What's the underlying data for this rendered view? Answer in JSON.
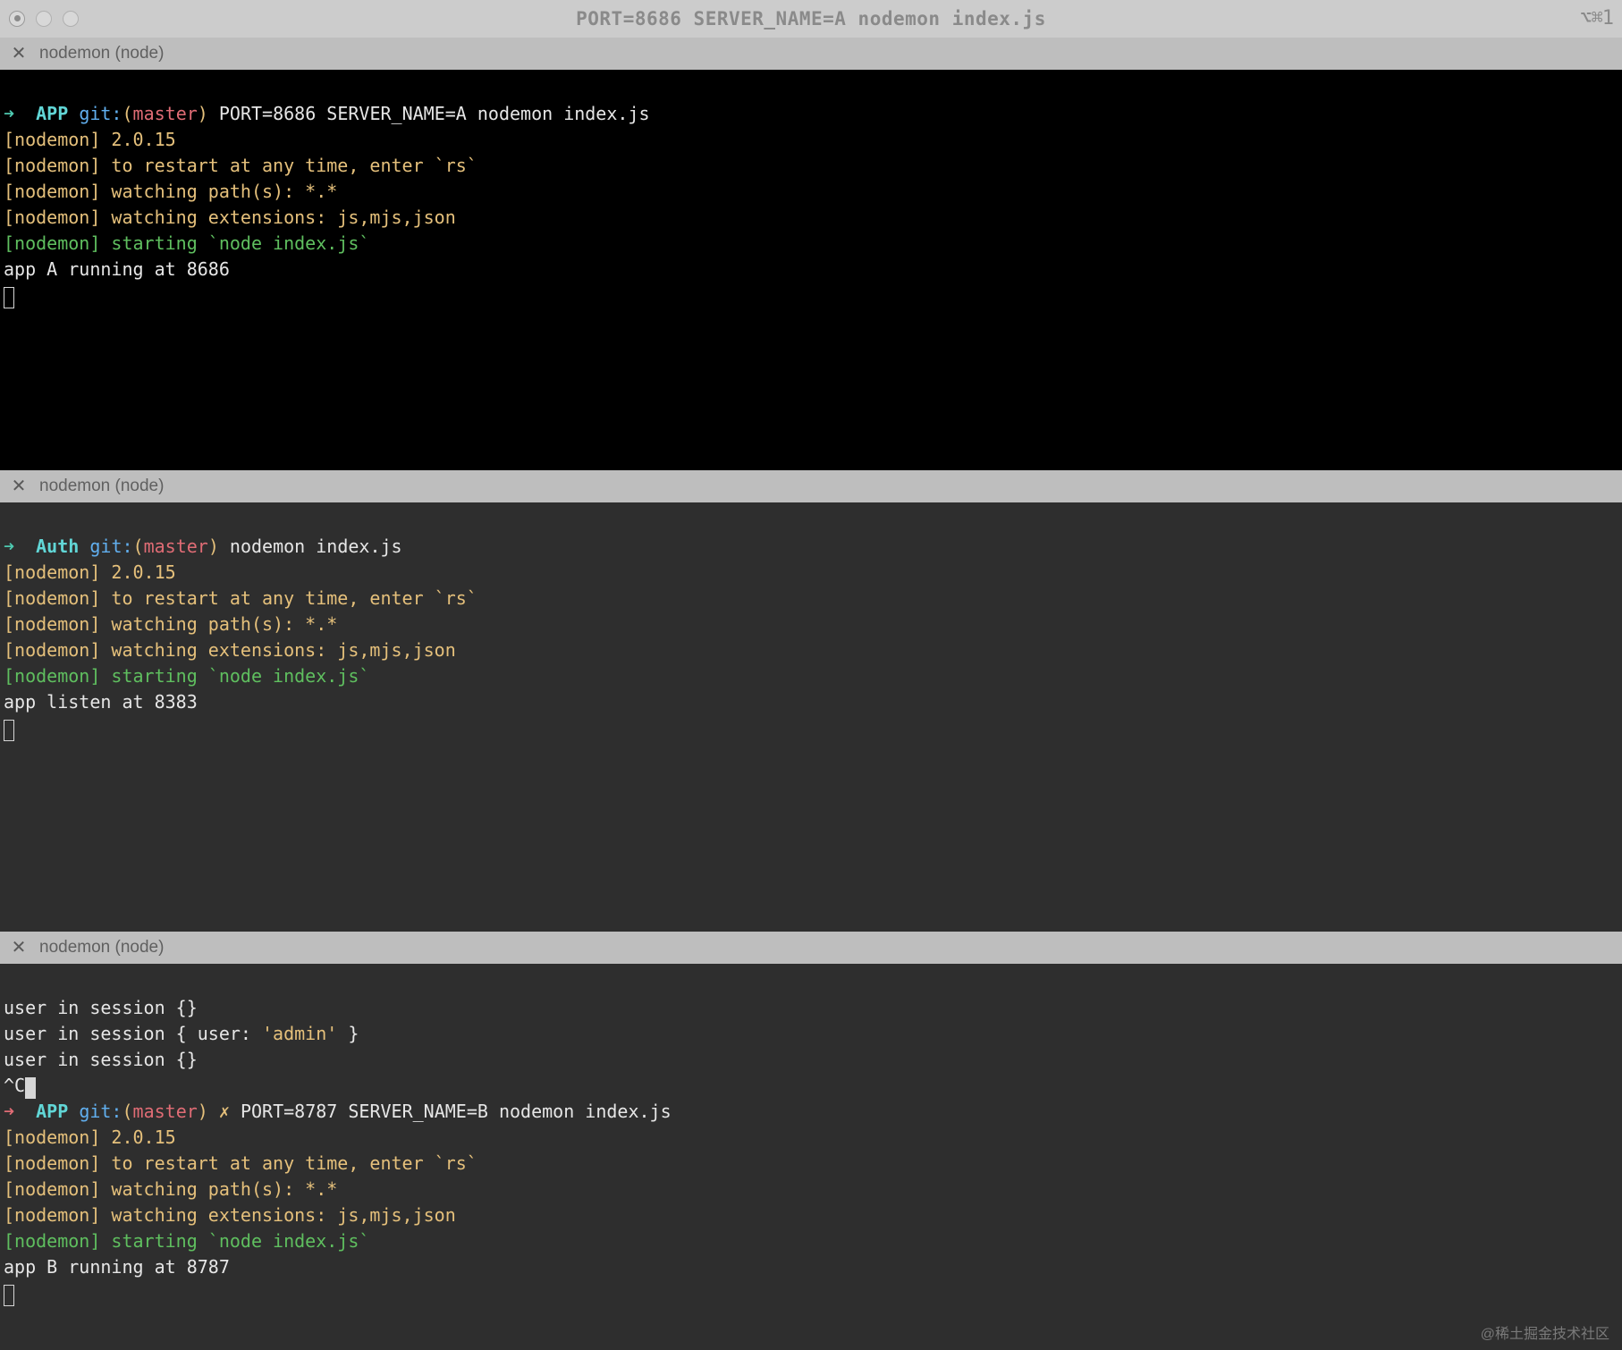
{
  "window": {
    "title": "PORT=8686 SERVER_NAME=A nodemon index.js",
    "right_glyph": "⌥⌘1"
  },
  "panes": [
    {
      "tab_label": "nodemon (node)",
      "prompt": {
        "arrow": "➜",
        "dir": "APP",
        "git_label": "git:",
        "branch": "master",
        "command": "PORT=8686 SERVER_NAME=A nodemon index.js"
      },
      "lines": [
        {
          "tag": "[nodemon]",
          "text": "2.0.15",
          "tag_class": "bracket"
        },
        {
          "tag": "[nodemon]",
          "text": "to restart at any time, enter `rs`",
          "tag_class": "bracket"
        },
        {
          "tag": "[nodemon]",
          "text": "watching path(s): *.*",
          "tag_class": "bracket"
        },
        {
          "tag": "[nodemon]",
          "text": "watching extensions: js,mjs,json",
          "tag_class": "bracket"
        },
        {
          "tag": "[nodemon]",
          "text": "starting `node index.js`",
          "tag_class": "green",
          "text_class": "green"
        }
      ],
      "output": "app A running at 8686"
    },
    {
      "tab_label": "nodemon (node)",
      "prompt": {
        "arrow": "➜",
        "dir": "Auth",
        "git_label": "git:",
        "branch": "master",
        "command": "nodemon index.js"
      },
      "lines": [
        {
          "tag": "[nodemon]",
          "text": "2.0.15",
          "tag_class": "bracket"
        },
        {
          "tag": "[nodemon]",
          "text": "to restart at any time, enter `rs`",
          "tag_class": "bracket"
        },
        {
          "tag": "[nodemon]",
          "text": "watching path(s): *.*",
          "tag_class": "bracket"
        },
        {
          "tag": "[nodemon]",
          "text": "watching extensions: js,mjs,json",
          "tag_class": "bracket"
        },
        {
          "tag": "[nodemon]",
          "text": "starting `node index.js`",
          "tag_class": "green",
          "text_class": "green"
        }
      ],
      "output": "app listen at 8383"
    },
    {
      "tab_label": "nodemon (node)",
      "pre_output": [
        "user in session {}",
        {
          "pre": "user in session { user: ",
          "str": "'admin'",
          "post": " }"
        },
        "user in session {}",
        "^C"
      ],
      "prompt": {
        "arrow": "➜",
        "arrow_red": true,
        "dir": "APP",
        "git_label": "git:",
        "branch": "master",
        "status_mark": "✗",
        "command": "PORT=8787 SERVER_NAME=B nodemon index.js"
      },
      "lines": [
        {
          "tag": "[nodemon]",
          "text": "2.0.15",
          "tag_class": "bracket"
        },
        {
          "tag": "[nodemon]",
          "text": "to restart at any time, enter `rs`",
          "tag_class": "bracket"
        },
        {
          "tag": "[nodemon]",
          "text": "watching path(s): *.*",
          "tag_class": "bracket"
        },
        {
          "tag": "[nodemon]",
          "text": "watching extensions: js,mjs,json",
          "tag_class": "bracket"
        },
        {
          "tag": "[nodemon]",
          "text": "starting `node index.js`",
          "tag_class": "green",
          "text_class": "green"
        }
      ],
      "output": "app B running at 8787"
    }
  ],
  "watermark": "@稀土掘金技术社区"
}
